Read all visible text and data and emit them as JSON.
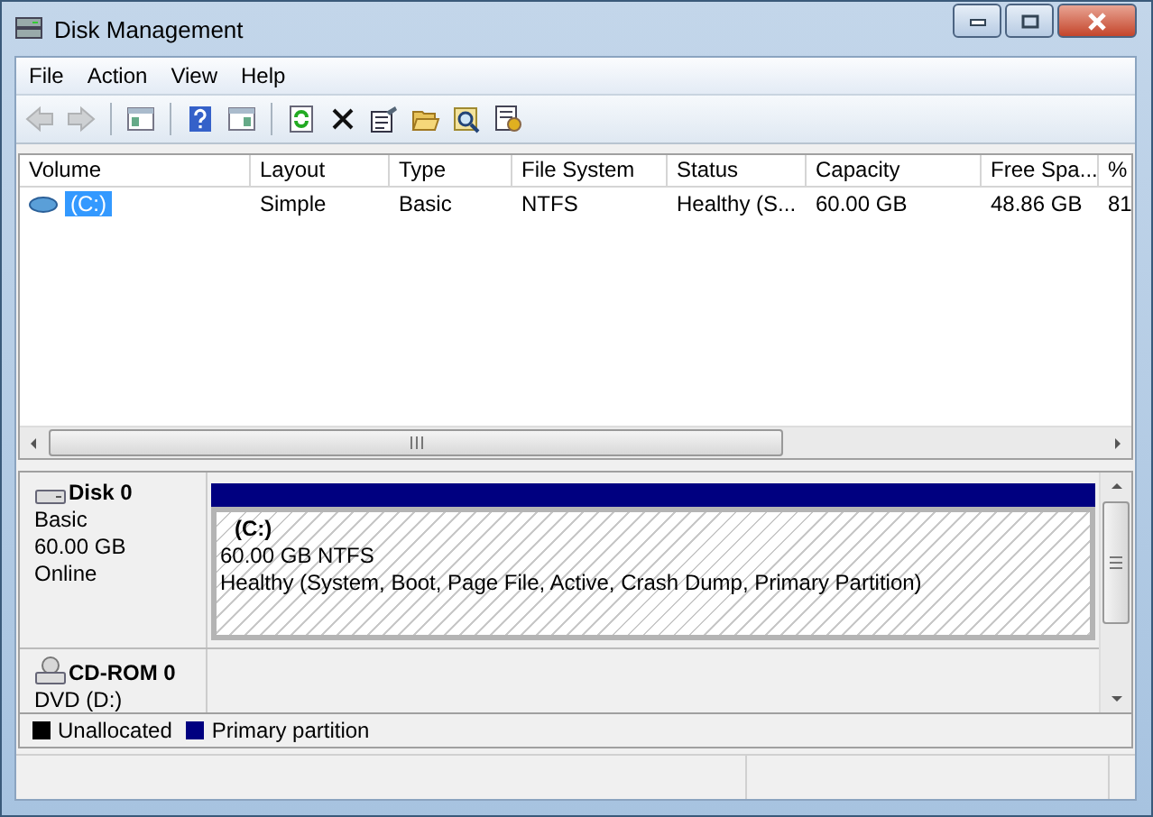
{
  "window": {
    "title": "Disk Management"
  },
  "menu": [
    "File",
    "Action",
    "View",
    "Help"
  ],
  "toolbar": [
    {
      "kind": "back",
      "disabled": true
    },
    {
      "kind": "forward",
      "disabled": true
    },
    {
      "kind": "sep"
    },
    {
      "kind": "tree",
      "disabled": false
    },
    {
      "kind": "sep"
    },
    {
      "kind": "help",
      "disabled": false
    },
    {
      "kind": "pane",
      "disabled": false
    },
    {
      "kind": "sep"
    },
    {
      "kind": "refresh",
      "disabled": false
    },
    {
      "kind": "delete",
      "disabled": false
    },
    {
      "kind": "properties",
      "disabled": false
    },
    {
      "kind": "open",
      "disabled": false
    },
    {
      "kind": "explore",
      "disabled": false
    },
    {
      "kind": "settings",
      "disabled": false
    }
  ],
  "volume_list": {
    "columns": [
      "Volume",
      "Layout",
      "Type",
      "File System",
      "Status",
      "Capacity",
      "Free Spa...",
      "%"
    ],
    "rows": [
      {
        "selected": true,
        "cells": [
          "(C:)",
          "Simple",
          "Basic",
          "NTFS",
          "Healthy (S...",
          "60.00 GB",
          "48.86 GB",
          "81"
        ]
      }
    ]
  },
  "disks": [
    {
      "kind": "disk",
      "name": "Disk 0",
      "details": [
        "Basic",
        "60.00 GB",
        "Online"
      ],
      "partitions": [
        {
          "name": "(C:)",
          "size": "60.00 GB NTFS",
          "status": "Healthy (System, Boot, Page File, Active, Crash Dump, Primary Partition)",
          "color": "#000080"
        }
      ]
    },
    {
      "kind": "cdrom",
      "name": "CD-ROM 0",
      "details": [
        "DVD (D:)"
      ]
    }
  ],
  "legend": [
    {
      "label": "Unallocated",
      "color": "#000000"
    },
    {
      "label": "Primary partition",
      "color": "#000080"
    }
  ]
}
